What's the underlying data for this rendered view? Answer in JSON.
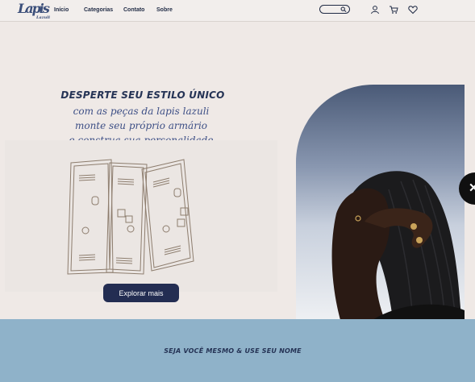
{
  "nav": {
    "logo": "Lapis",
    "logo_sub": "Lazuli",
    "links": [
      "Início",
      "Categorias",
      "Contato",
      "Sobre"
    ],
    "icons": [
      "search-icon",
      "user-icon",
      "cart-icon",
      "heart-icon"
    ]
  },
  "hero": {
    "title": "DESPERTE SEU ESTILO ÚNICO",
    "lines": [
      "com as peças da lapis lazuli",
      "monte seu próprio armário",
      "e construa sua personalidade"
    ],
    "cta": "Explorar mais",
    "next_icon": "close-icon"
  },
  "banner": {
    "text": "SEJA VOCÊ MESMO & USE SEU NOME"
  },
  "colors": {
    "background": "#efe9e6",
    "navy": "#232d52",
    "banner": "#8fb2c9"
  }
}
